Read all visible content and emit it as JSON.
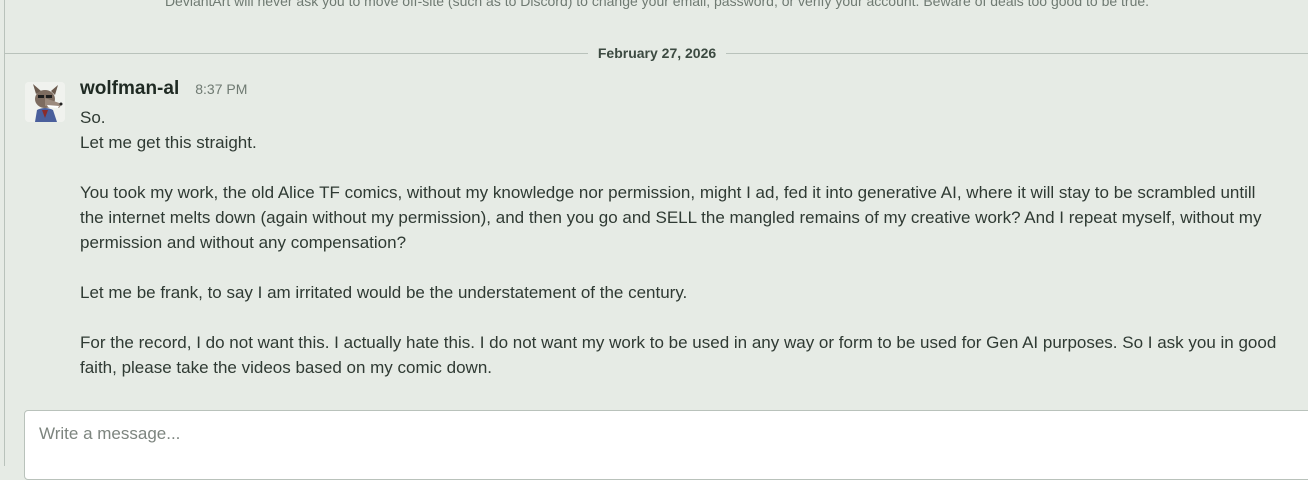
{
  "notice": {
    "text": "DeviantArt will never ask you to move off-site (such as to Discord) to change your email, password, or verify your account. Beware of deals too good to be true."
  },
  "date_separator": "February 27, 2026",
  "message": {
    "username": "wolfman-al",
    "time": "8:37 PM",
    "avatar_icon": "wolf-avatar",
    "lines": [
      "So.",
      "Let me get this straight."
    ],
    "paragraph1": "You took my work, the old Alice TF comics, without my knowledge nor permission, might I ad, fed it into generative AI, where it will stay to be scrambled untill the internet melts down (again without my permission), and then you go and SELL the mangled remains of my creative work? And I repeat myself, without my permission and without any compensation?",
    "paragraph2": "Let me be frank, to say I am irritated would be the understatement of the century.",
    "paragraph3": "For the record, I do not want this. I actually hate this. I do not want my work to be used in any way or form to be used for Gen AI purposes. So I ask you in good faith, please take the videos based on my comic down."
  },
  "composer": {
    "placeholder": "Write a message..."
  }
}
